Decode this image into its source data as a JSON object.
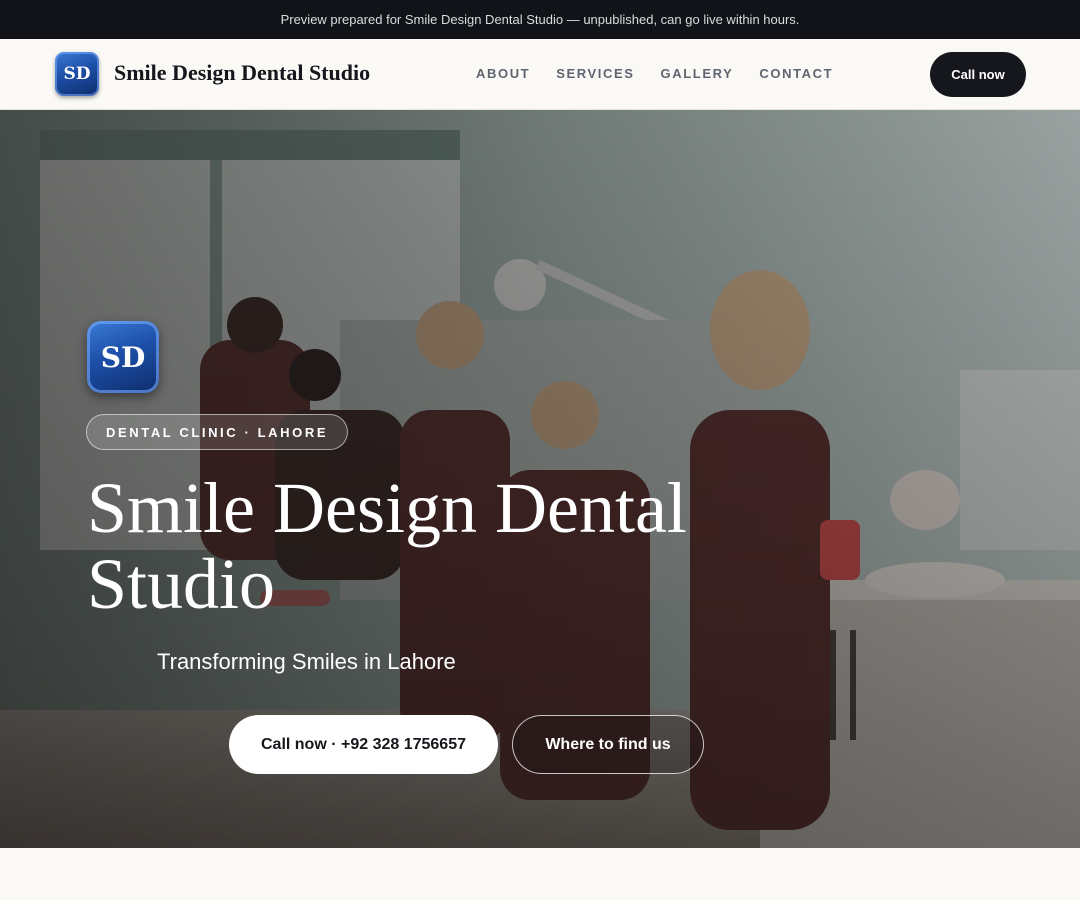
{
  "preview_banner": {
    "text": "Preview prepared for Smile Design Dental Studio — unpublished, can go live within hours."
  },
  "header": {
    "logo_initials": "SD",
    "brand_name": "Smile Design Dental Studio",
    "nav": [
      {
        "label": "ABOUT"
      },
      {
        "label": "SERVICES"
      },
      {
        "label": "GALLERY"
      },
      {
        "label": "CONTACT"
      }
    ],
    "cta_label": "Call now"
  },
  "hero": {
    "logo_initials": "SD",
    "tag": "DENTAL CLINIC · LAHORE",
    "title": "Smile Design Dental Studio",
    "subtitle": "Transforming Smiles in Lahore",
    "primary_button": "Call now · +92 328 1756657",
    "secondary_button": "Where to find us"
  },
  "colors": {
    "dark": "#111318",
    "logo_blue": "#1d4fa8",
    "page_bg": "#faf9f6"
  }
}
